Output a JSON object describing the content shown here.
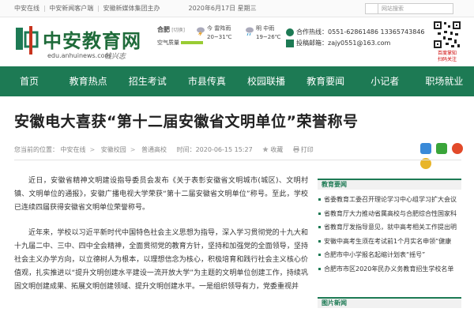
{
  "topbar": {
    "links": [
      "中安在线",
      "中安新闻客户端",
      "安徽新媒体集团主办"
    ],
    "date": "2020年6月17日 星期三",
    "search_placeholder": "网站搜索"
  },
  "header": {
    "logo_text": "中安教育网",
    "logo_url": "edu.anhuinews.com",
    "logo_signature": "钱兴志"
  },
  "weather": {
    "city": "合肥",
    "switch_label": "[切换]",
    "air_quality_label": "空气质量",
    "today": {
      "label": "今",
      "condition": "雷阵雨",
      "temp": "20~31℃"
    },
    "tomorrow": {
      "label": "明",
      "condition": "中雨",
      "temp": "19~26℃"
    }
  },
  "contact": {
    "phone": "合作热线：0551-62861486 13365743846",
    "email": "投稿邮箱：zajy0551@163.com"
  },
  "qr_caption": "百度掌知\n扫码关注",
  "nav": [
    "首页",
    "教育热点",
    "招生考试",
    "市县传真",
    "校园联播",
    "教育要闻",
    "小记者",
    "职场就业"
  ],
  "article": {
    "title": "安徽电大喜获“第十二届安徽省文明单位”荣誉称号",
    "breadcrumb_label": "您当前的位置：",
    "breadcrumbs": [
      "中安在线",
      "安徽校园",
      "普通高校"
    ],
    "time": "时间：2020-06-15 15:27",
    "favorite_label": "收藏",
    "print_label": "打印",
    "paragraphs": [
      "近日，安徽省精神文明建设指导委员会发布《关于表彰安徽省文明城市(城区)、文明村镇、文明单位的通报》，安徽广播电视大学荣获“第十二届安徽省文明单位”称号。至此，学校已连续四届获得安徽省文明单位荣誉称号。",
      "近年来，学校以习近平新时代中国特色社会主义思想为指导，深入学习贯彻党的十九大和十九届二中、三中、四中全会精神，全面贯彻党的教育方针，坚持和加强党的全面领导，坚持社会主义办学方向，以立德树人为根本，以理想信念为核心，积极培育和践行社会主义核心价值观，扎实推进以“提升文明创建水平建设一流开放大学”为主题的文明单位创建工作，持续巩固文明创建成果、拓展文明创建领域、提升文明创建水平。一是组织领导有力，党委重视并"
    ]
  },
  "sidebar": {
    "section1_title": "教育要闻",
    "items": [
      "省委教育工委召开理论学习中心组学习扩大会议",
      "省教育厅大力推动省属高校与合肥综合性国家科",
      "省教育厅发指导意见，就中高考相关工作提出明",
      "安徽中高考生须在考试前1个月实名申领“健康",
      "合肥市中小学报名起缩计划表“摇号”",
      "合肥市市区2020年民办义务教育招生学校名单"
    ],
    "section2_title": "图片新闻"
  },
  "colors": {
    "brand_green": "#1d7a54"
  }
}
